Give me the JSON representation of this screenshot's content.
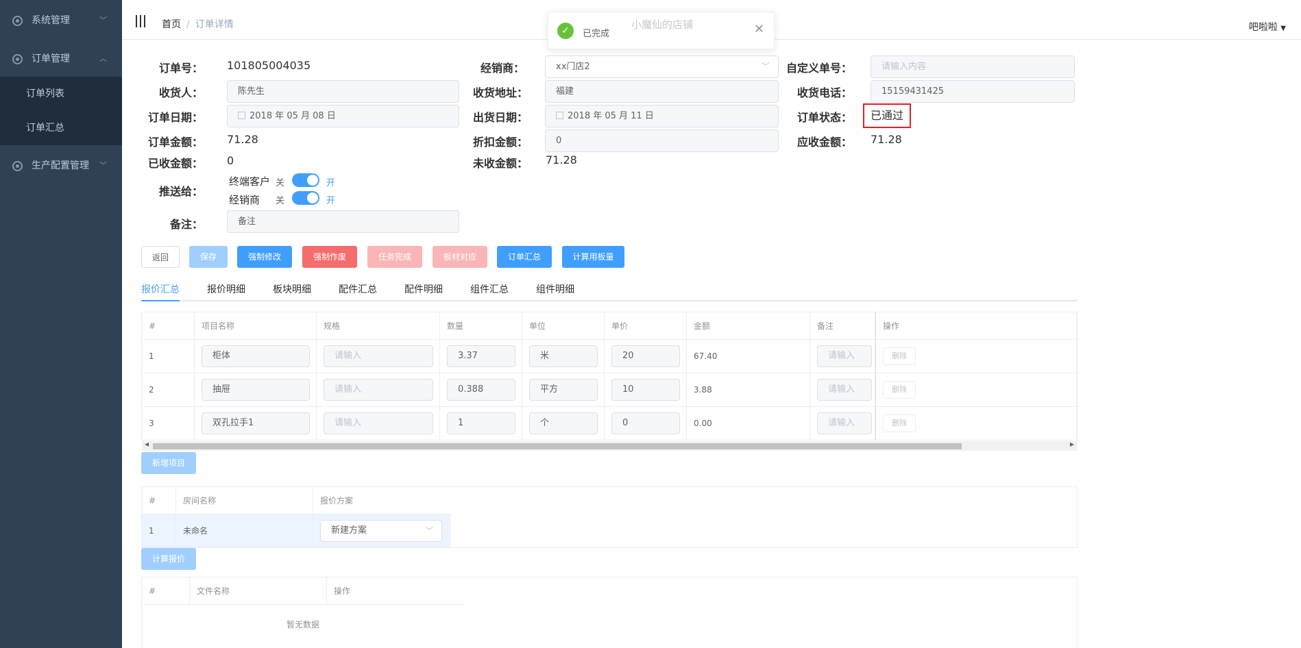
{
  "sidebar": {
    "menus": [
      {
        "label": "系统管理"
      },
      {
        "label": "订单管理"
      },
      {
        "label": "生产配置管理"
      }
    ],
    "sub_items": [
      {
        "label": "订单列表"
      },
      {
        "label": "订单汇总"
      }
    ]
  },
  "navbar": {
    "breadcrumb": [
      {
        "label": "首页"
      },
      {
        "label": "订单详情"
      }
    ],
    "separator": "/",
    "user": "吧啦啦"
  },
  "toast": {
    "message": "已完成",
    "watermark": "小魔仙的店铺"
  },
  "form": {
    "order_no": {
      "label": "订单号：",
      "value": "101805004035"
    },
    "dealer": {
      "label": "经销商：",
      "value": "xx门店2"
    },
    "custom_no": {
      "label": "自定义单号：",
      "placeholder": "请输入内容"
    },
    "receiver": {
      "label": "收货人：",
      "value": "陈先生"
    },
    "address": {
      "label": "收货地址：",
      "value": "福建"
    },
    "phone": {
      "label": "收货电话：",
      "value": "15159431425"
    },
    "order_date": {
      "label": "订单日期：",
      "value": "2018 年 05 月 08 日"
    },
    "ship_date": {
      "label": "出货日期：",
      "value": "2018 年 05 月 11 日"
    },
    "status": {
      "label": "订单状态：",
      "value": "已通过"
    },
    "amount": {
      "label": "订单金额：",
      "value": "71.28"
    },
    "discount": {
      "label": "折扣金额：",
      "value": "0"
    },
    "receivable": {
      "label": "应收金额：",
      "value": "71.28"
    },
    "received": {
      "label": "已收金额：",
      "value": "0"
    },
    "unreceived": {
      "label": "未收金额：",
      "value": "71.28"
    },
    "push": {
      "label": "推送给：",
      "items": [
        {
          "name": "终端客户",
          "off": "关",
          "on": "开",
          "checked": true
        },
        {
          "name": "经销商",
          "off": "关",
          "on": "开",
          "checked": true
        }
      ]
    },
    "remark": {
      "label": "备注：",
      "value": "备注"
    }
  },
  "buttons": [
    {
      "label": "返回",
      "color": "#ffffff"
    },
    {
      "label": "保存",
      "color": "#a0cfff"
    },
    {
      "label": "强制修改",
      "color": "#409eff"
    },
    {
      "label": "强制作废",
      "color": "#f56c6c"
    },
    {
      "label": "任务完成",
      "color": "#fab6b6"
    },
    {
      "label": "板材对应",
      "color": "#fab6b6"
    },
    {
      "label": "订单汇总",
      "color": "#409eff"
    },
    {
      "label": "计算用板量",
      "color": "#409eff"
    }
  ],
  "tabs": [
    {
      "label": "报价汇总",
      "active": true
    },
    {
      "label": "报价明细"
    },
    {
      "label": "板块明细"
    },
    {
      "label": "配件汇总"
    },
    {
      "label": "配件明细"
    },
    {
      "label": "组件汇总"
    },
    {
      "label": "组件明细"
    }
  ],
  "quote_table": {
    "headers": [
      "#",
      "项目名称",
      "规格",
      "数量",
      "单位",
      "单价",
      "金额",
      "备注",
      "操作"
    ],
    "rows": [
      {
        "idx": "1",
        "name": "柜体",
        "spec": "请输入",
        "qty": "3.37",
        "unit": "米",
        "price": "20",
        "amount": "67.40",
        "remark": "请输入",
        "action": "删除"
      },
      {
        "idx": "2",
        "name": "抽屉",
        "spec": "请输入",
        "qty": "0.388",
        "unit": "平方",
        "price": "10",
        "amount": "3.88",
        "remark": "请输入",
        "action": "删除"
      },
      {
        "idx": "3",
        "name": "双孔拉手1",
        "spec": "请输入",
        "qty": "1",
        "unit": "个",
        "price": "0",
        "amount": "0.00",
        "remark": "请输入",
        "action": "删除"
      }
    ],
    "add_label": "新增项目"
  },
  "room_table": {
    "headers": [
      "#",
      "房间名称",
      "报价方案"
    ],
    "rows": [
      {
        "idx": "1",
        "name": "未命名",
        "plan": "新建方案"
      }
    ],
    "calc_label": "计算报价"
  },
  "file_table": {
    "headers": [
      "#",
      "文件名称",
      "操作"
    ],
    "empty": "暂无数据"
  }
}
